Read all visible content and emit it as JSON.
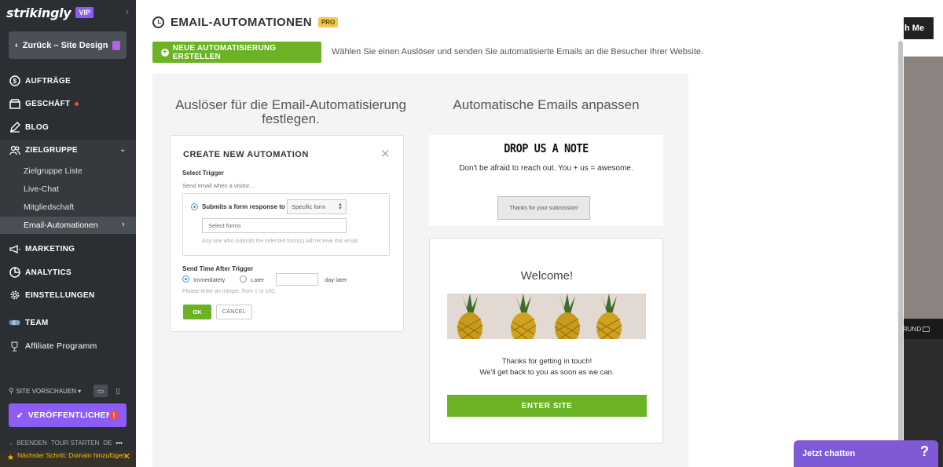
{
  "brand": {
    "logo": "strikingly",
    "badge": "VIP"
  },
  "sidebar": {
    "back_label": "Zurück – Site Design",
    "items": [
      {
        "label": "AUFTRÄGE",
        "icon": "dollar-circle-icon"
      },
      {
        "label": "GESCHÄFT",
        "icon": "store-icon"
      },
      {
        "label": "BLOG",
        "icon": "pen-icon"
      },
      {
        "label": "ZIELGRUPPE",
        "icon": "people-icon"
      },
      {
        "label": "MARKETING",
        "icon": "megaphone-icon"
      },
      {
        "label": "ANALYTICS",
        "icon": "pie-chart-icon"
      },
      {
        "label": "EINSTELLUNGEN",
        "icon": "gear-icon"
      },
      {
        "label": "TEAM",
        "icon": "team-icon"
      },
      {
        "label": "Affiliate Programm",
        "icon": "trophy-icon"
      }
    ],
    "sub_items": [
      "Zielgruppe Liste",
      "Live-Chat",
      "Mitgliedschaft",
      "Email-Automationen"
    ],
    "preview_label": "SITE VORSCHAUEN",
    "publish_label": "VERÖFFENTLICHEN",
    "bottom_links": [
      "BEENDEN",
      "TOUR STARTEN",
      "DE",
      "•••"
    ],
    "next_step": "Nächster Schritt: Domain hinzufügen"
  },
  "main": {
    "title": "EMAIL-AUTOMATIONEN",
    "badge": "PRO",
    "new_button": "NEUE AUTOMATISIERUNG ERSTELLEN",
    "description": "Wählen Sie einen Auslöser und senden Sie automatisierte Emails an die Besucher Ihrer Website.",
    "left_title": "Auslöser für die Email-Automatisierung festlegen.",
    "right_title": "Automatische Emails anpassen"
  },
  "modal": {
    "title": "CREATE NEW AUTOMATION",
    "select_trigger": "Select Trigger",
    "send_when": "Send email when a visitor...",
    "option_label": "Submits a form response to",
    "select_value": "Specific form",
    "forms_placeholder": "Select forms",
    "hint": "Any one who submits the selected form(s) will receive this email.",
    "send_time": "Send Time After Trigger",
    "immediately": "Immediately",
    "later": "Later",
    "day_later": "day later",
    "integer_hint": "Please enter an integer, from 1 to 100.",
    "ok": "OK",
    "cancel": "CANCEL"
  },
  "preview": {
    "note_title": "DROP US A NOTE",
    "note_sub": "Don't be afraid to reach out. You + us = awesome.",
    "note_button": "Thanks for your submission!",
    "welcome": "Welcome!",
    "thanks_line1": "Thanks for getting in touch!",
    "thanks_line2": "We'll get back to you as soon as we can.",
    "enter_button": "ENTER SITE"
  },
  "background_site": {
    "touch_button": "h Me",
    "strip_text": "RUND"
  },
  "chat": {
    "label": "Jetzt chatten",
    "help": "?"
  },
  "colors": {
    "sidebar": "#2b2f33",
    "accent_green": "#6bb324",
    "accent_purple": "#8b5cf6",
    "chat_purple": "#7e5ad6"
  }
}
